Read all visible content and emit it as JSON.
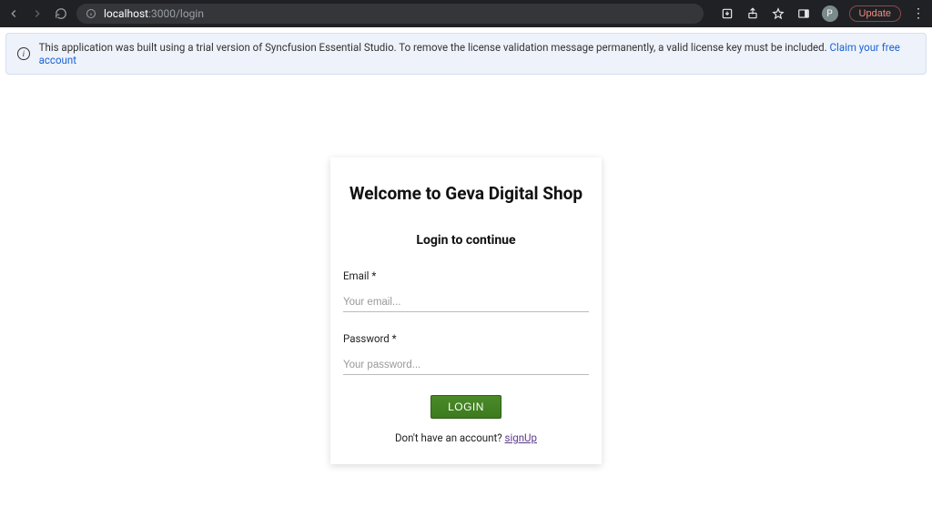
{
  "chrome": {
    "url_host": "localhost",
    "url_port_path": ":3000/login",
    "avatar_letter": "P",
    "update_label": "Update"
  },
  "banner": {
    "text": "This application was built using a trial version of Syncfusion Essential Studio. To remove the license validation message permanently, a valid license key must be included. ",
    "link_text": "Claim your free account"
  },
  "login": {
    "title": "Welcome to Geva Digital Shop",
    "subtitle": "Login to continue",
    "email_label": "Email *",
    "email_placeholder": "Your email...",
    "password_label": "Password *",
    "password_placeholder": "Your password...",
    "button_label": "LOGIN",
    "no_account_text": "Don't have an account? ",
    "signup_link": "signUp"
  }
}
